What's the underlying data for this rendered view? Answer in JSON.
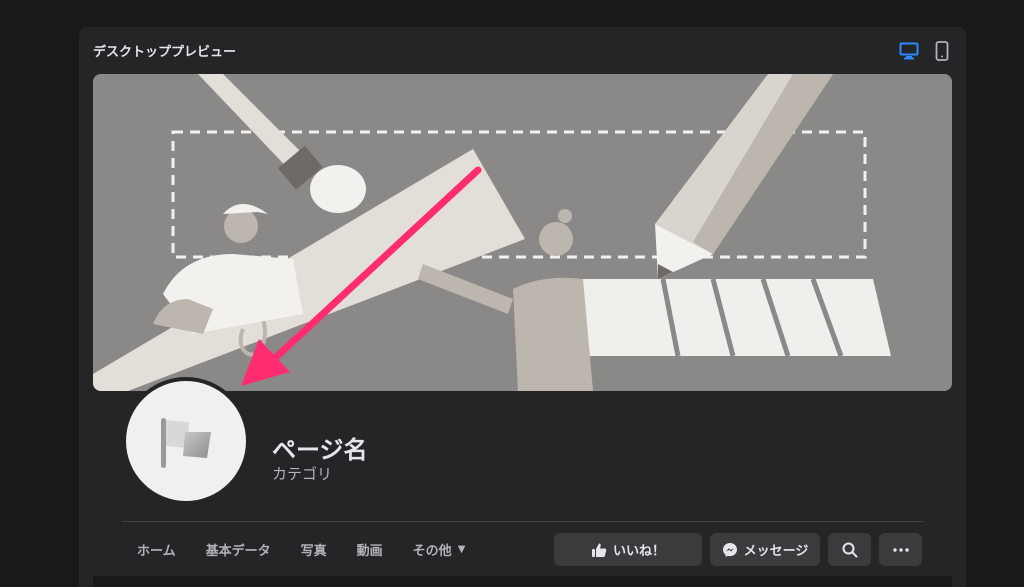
{
  "panel": {
    "title": "デスクトッププレビュー",
    "device_icons": [
      "desktop-icon",
      "mobile-icon"
    ],
    "active_device": "desktop",
    "accent_color": "#2d88ff"
  },
  "page": {
    "name": "ページ名",
    "category": "カテゴリ"
  },
  "nav": {
    "tabs": [
      "ホーム",
      "基本データ",
      "写真",
      "動画"
    ],
    "more_label": "その他"
  },
  "actions": {
    "like_label": "いいね！",
    "message_label": "メッセージ",
    "search_icon": "search-icon",
    "more_icon": "more-icon"
  },
  "annotation": {
    "arrow_color": "#ff2d6f"
  }
}
